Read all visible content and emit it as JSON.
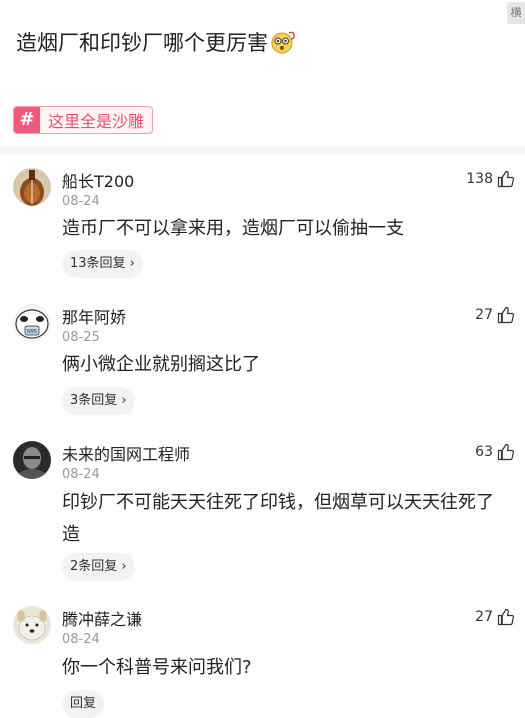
{
  "post": {
    "title": "造烟厂和印钞厂哪个更厉害",
    "corner_text": "横"
  },
  "topic": {
    "label": "这里全是沙雕"
  },
  "comments": [
    {
      "name": "船长T200",
      "date": "08-24",
      "text": "造币厂不可以拿来用，造烟厂可以偷抽一支",
      "replies": "13条回复",
      "likes": "138"
    },
    {
      "name": "那年阿娇",
      "date": "08-25",
      "text": "俩小微企业就别搁这比了",
      "replies": "3条回复",
      "likes": "27"
    },
    {
      "name": "未来的国网工程师",
      "date": "08-24",
      "text": "印钞厂不可能天天往死了印钱，但烟草可以天天往死了造",
      "replies": "2条回复",
      "likes": "63"
    },
    {
      "name": "腾冲薛之谦",
      "date": "08-24",
      "text": "你一个科普号来问我们?",
      "replies": "回复",
      "likes": "27"
    }
  ],
  "icons": {
    "like": "thumbs-up-icon",
    "reply_arrow": "chevron-right-icon",
    "topic": "hash-icon"
  },
  "colors": {
    "accent": "#ef5a7a"
  }
}
